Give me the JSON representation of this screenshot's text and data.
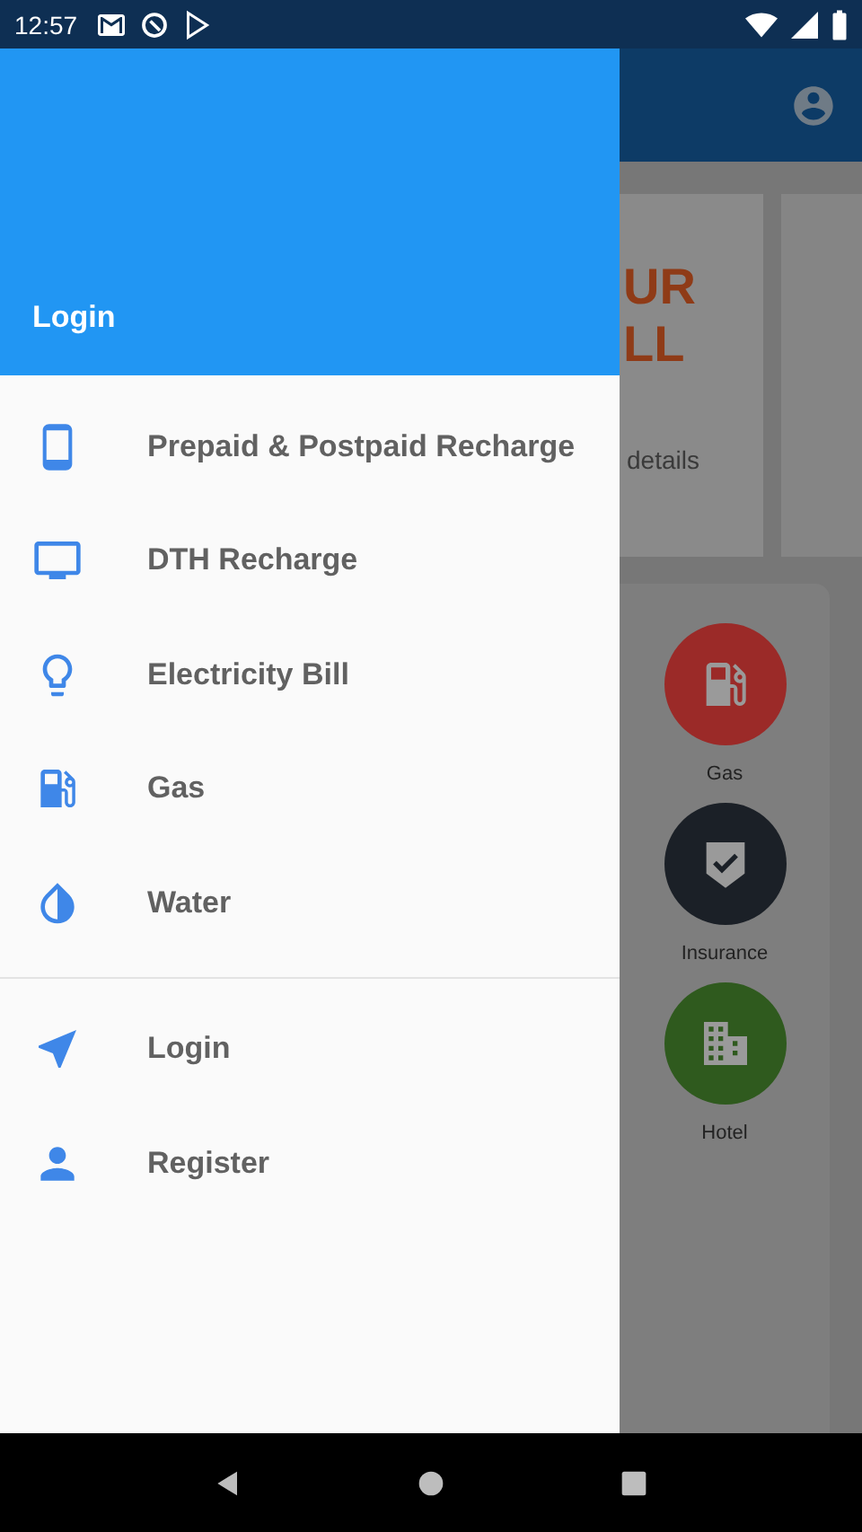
{
  "status_bar": {
    "time": "12:57"
  },
  "drawer": {
    "header_title": "Login",
    "services": [
      {
        "label": "Prepaid & Postpaid Recharge"
      },
      {
        "label": "DTH Recharge"
      },
      {
        "label": "Electricity Bill"
      },
      {
        "label": "Gas"
      },
      {
        "label": "Water"
      }
    ],
    "account": [
      {
        "label": "Login"
      },
      {
        "label": "Register"
      }
    ]
  },
  "background_app": {
    "banner_texts": [
      "UR",
      "LL",
      "details"
    ],
    "services": [
      {
        "label": "Gas",
        "color": "#9b2a28"
      },
      {
        "label": "Insurance",
        "color": "#1b2027"
      },
      {
        "label": "Hotel",
        "color": "#2f5a1e"
      }
    ]
  }
}
